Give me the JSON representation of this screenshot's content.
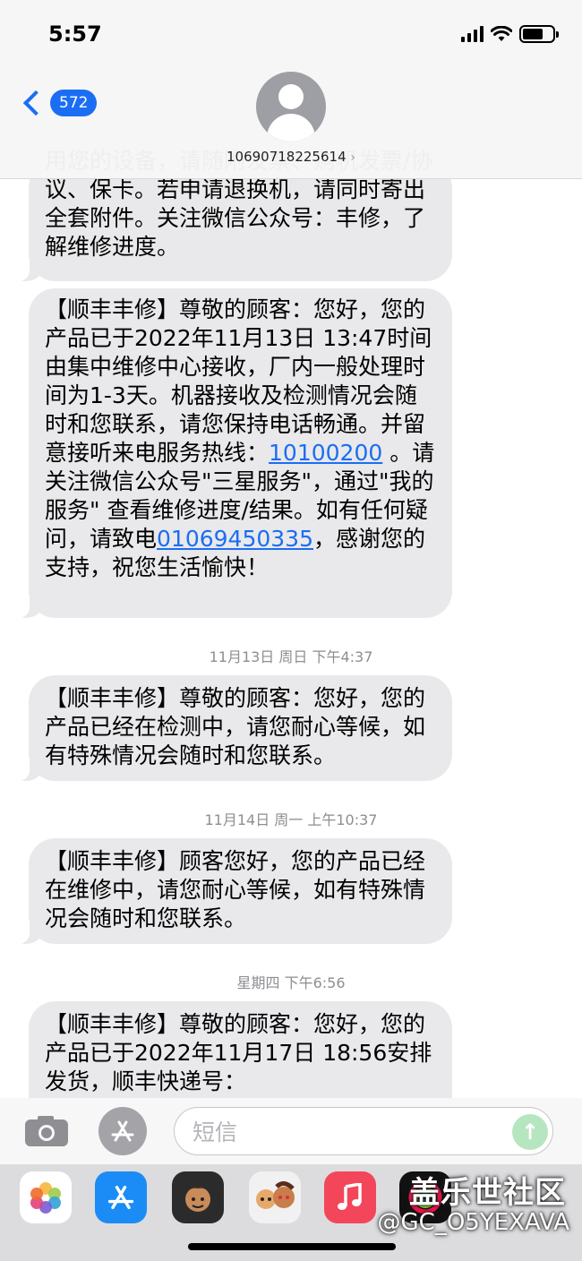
{
  "status_bar": {
    "time": "5:57"
  },
  "nav": {
    "unread_count": "572",
    "contact_number": "10690718225614",
    "chevron": "›"
  },
  "messages": [
    {
      "lines": [
        "号：丰修，了解维修进度。"
      ],
      "prefix": "发票/协议、保卡。若申请退换机，请同时寄出全套附件。关注微信公众",
      "partial_top": "用您的设备，请随附发票、购机"
    },
    {
      "text_a": "【顺丰丰修】尊敬的顾客：您好，您的产品已于2022年11月13日 13:47时间由集中维修中心接收，厂内一般处理时间为1-3天。机器接收及检测情况会随时和您联系，请您保持电话畅通。并留意接听来电服务热线：",
      "link_a": "10100200",
      "text_b": " 。请关注微信公众号\"三星服务\"，通过\"我的服务\" 查看维修进度/结果。如有任何疑问，请致电",
      "link_b": "01069450335",
      "text_c": "，感谢您的支持，祝您生活愉快！"
    },
    {
      "text": "【顺丰丰修】尊敬的顾客：您好，您的产品已经在检测中，请您耐心等候，如有特殊情况会随时和您联系。"
    },
    {
      "text": "【顺丰丰修】顾客您好，您的产品已经在维修中，请您耐心等候，如有特殊情况会随时和您联系。"
    },
    {
      "text": "【顺丰丰修】尊敬的顾客：您好，您的产品已于2022年11月17日 18:56安排发货，顺丰快递号："
    }
  ],
  "timestamps": [
    "11月13日 周日 下午4:37",
    "11月14日 周一 上午10:37",
    "星期四 下午6:56"
  ],
  "input": {
    "placeholder": "短信",
    "send_icon": "↑"
  },
  "watermark": {
    "title": "盖乐世社区",
    "user": "@GC_O5YEXAVA"
  },
  "apps": [
    "photos-icon",
    "app-store-icon",
    "memoji-icon",
    "memoji-stickers-icon",
    "music-icon",
    "fitness-icon"
  ]
}
